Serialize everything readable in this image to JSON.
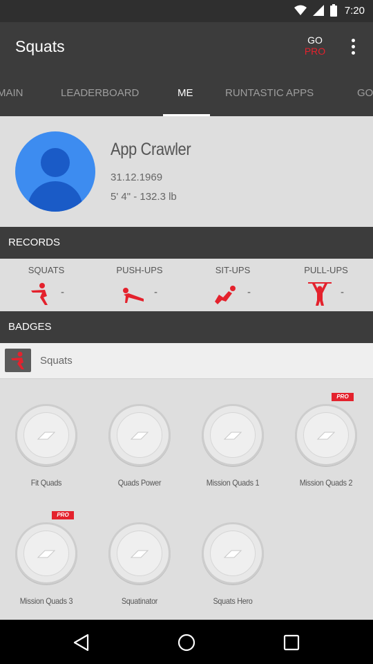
{
  "status_bar": {
    "time": "7:20"
  },
  "app_bar": {
    "title": "Squats",
    "go_label": "GO",
    "pro_label": "PRO"
  },
  "tabs": [
    {
      "label": "MAIN"
    },
    {
      "label": "LEADERBOARD"
    },
    {
      "label": "ME",
      "active": true
    },
    {
      "label": "RUNTASTIC APPS"
    },
    {
      "label": "GO"
    }
  ],
  "profile": {
    "name": "App Crawler",
    "birthdate": "31.12.1969",
    "height_weight": "5' 4\" - 132.3 lb"
  },
  "records": {
    "header": "RECORDS",
    "items": [
      {
        "label": "SQUATS",
        "value": "-"
      },
      {
        "label": "PUSH-UPS",
        "value": "-"
      },
      {
        "label": "SIT-UPS",
        "value": "-"
      },
      {
        "label": "PULL-UPS",
        "value": "-"
      }
    ]
  },
  "badges": {
    "header": "BADGES",
    "filter_label": "Squats",
    "items": [
      {
        "label": "Fit Quads",
        "pro": false
      },
      {
        "label": "Quads Power",
        "pro": false
      },
      {
        "label": "Mission Quads 1",
        "pro": false
      },
      {
        "label": "Mission Quads 2",
        "pro": true
      },
      {
        "label": "Mission Quads 3",
        "pro": true
      },
      {
        "label": "Squatinator",
        "pro": false
      },
      {
        "label": "Squats Hero",
        "pro": false
      }
    ],
    "pro_badge_text": "PRO"
  },
  "colors": {
    "accent_red": "#e4222d",
    "avatar_blue": "#3d8cf0",
    "toolbar": "#3c3c3c",
    "content_bg": "#dedede"
  }
}
